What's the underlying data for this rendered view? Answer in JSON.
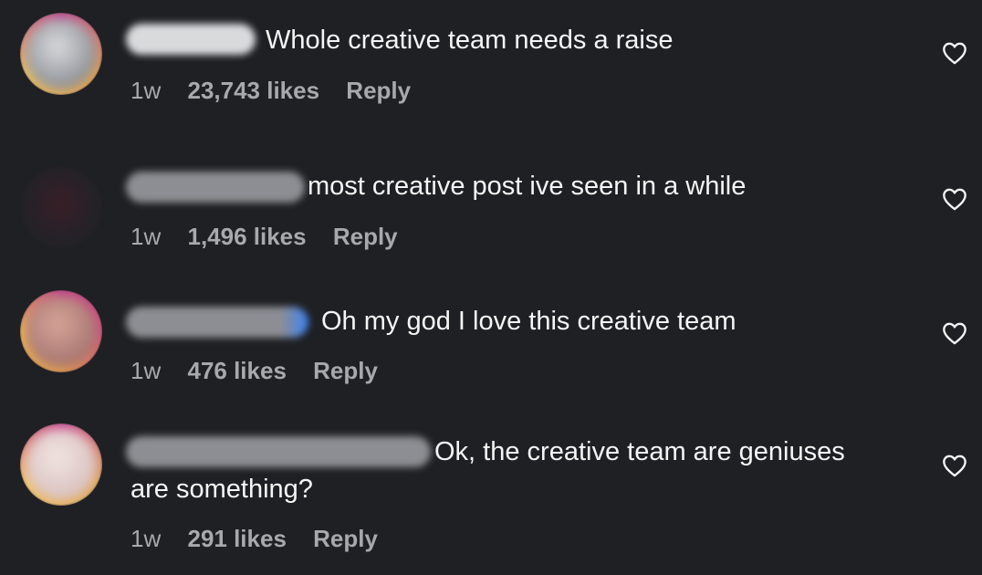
{
  "comments": [
    {
      "text": "Whole creative team needs a raise",
      "age": "1w",
      "likes": "23,743 likes",
      "reply": "Reply",
      "avatar_ring": "#e9a04a",
      "avatar_photo": "#b9bdc3",
      "username_blur": "#d9dadc"
    },
    {
      "text": "most creative post ive seen in a while",
      "age": "1w",
      "likes": "1,496 likes",
      "reply": "Reply",
      "avatar_ring": "#222226",
      "avatar_photo": "#2a1e22",
      "username_blur": "#8d8e93"
    },
    {
      "text": "Oh my god I love this creative team",
      "age": "1w",
      "likes": "476 likes",
      "reply": "Reply",
      "avatar_ring": "#d04f7a",
      "avatar_photo": "#b98a84",
      "username_blur": "#8d8e93"
    },
    {
      "text": "Ok, the creative team are geniuses",
      "text_cont": "are something?",
      "age": "1w",
      "likes": "291 likes",
      "reply": "Reply",
      "avatar_ring": "#e0a44d",
      "avatar_photo": "#e3d2d0",
      "username_blur": "#8d8e93"
    }
  ],
  "icons": {
    "like": "heart-outline-icon"
  },
  "colors": {
    "background": "#1f2024",
    "text": "#f5f5f5",
    "meta": "#a8a8ad",
    "accent_blue": "#3b82f6"
  }
}
